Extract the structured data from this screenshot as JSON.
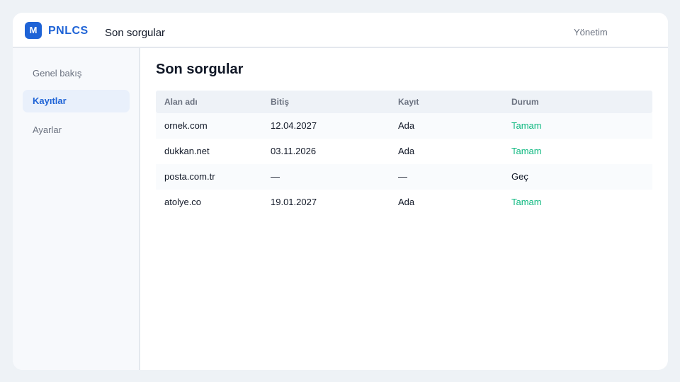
{
  "app": {
    "logo_letter": "M",
    "brand": "PNLCS",
    "header_title": "Son sorgular",
    "admin_label": "Yönetim"
  },
  "sidebar": {
    "items": [
      {
        "label": "Genel bakış",
        "active": false
      },
      {
        "label": "Kayıtlar",
        "active": true
      },
      {
        "label": "Ayarlar",
        "active": false
      }
    ]
  },
  "main": {
    "title": "Son sorgular",
    "columns": [
      "Alan adı",
      "Bitiş",
      "Kayıt",
      "Durum"
    ],
    "rows": [
      {
        "domain": "ornek.com",
        "expiry": "12.04.2027",
        "registrar": "Ada",
        "status": "Tamam"
      },
      {
        "domain": "dukkan.net",
        "expiry": "03.11.2026",
        "registrar": "Ada",
        "status": "Tamam"
      },
      {
        "domain": "posta.com.tr",
        "expiry": "—",
        "registrar": "—",
        "status": "Geç"
      },
      {
        "domain": "atolye.co",
        "expiry": "19.01.2027",
        "registrar": "Ada",
        "status": "Tamam"
      }
    ]
  },
  "colors": {
    "accent": "#1e63d6",
    "status_ok": "#10b981",
    "background": "#eef2f6"
  }
}
